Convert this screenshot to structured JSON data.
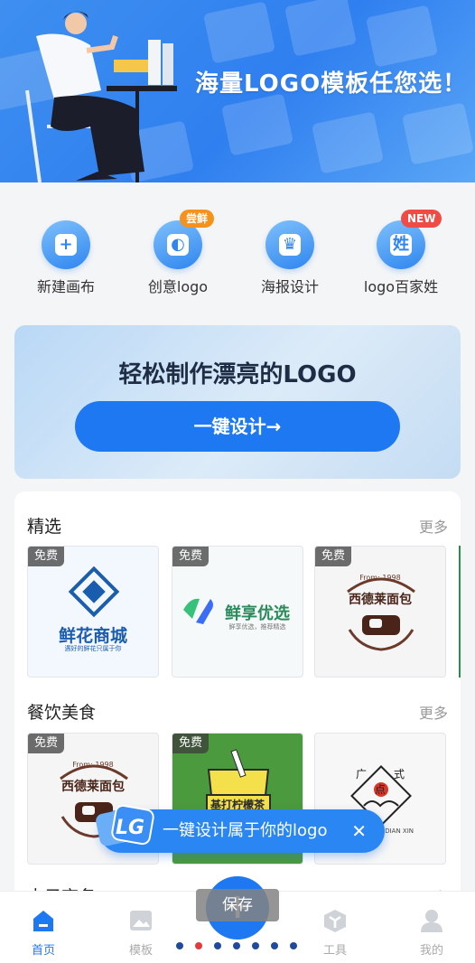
{
  "hero": {
    "title": "海量LOGO模板任您选！"
  },
  "actions": [
    {
      "label": "新建画布",
      "icon": "new-canvas-icon",
      "glyph": "+"
    },
    {
      "label": "创意logo",
      "icon": "creative-logo-icon",
      "glyph": "◐",
      "badge": "尝鲜"
    },
    {
      "label": "海报设计",
      "icon": "poster-design-icon",
      "glyph": "♛"
    },
    {
      "label": "logo百家姓",
      "icon": "surname-logo-icon",
      "glyph": "姓",
      "badge": "NEW"
    }
  ],
  "banner": {
    "title": "轻松制作漂亮的LOGO",
    "button": "一键设计→"
  },
  "sections": [
    {
      "title": "精选",
      "more": "更多",
      "templates": [
        {
          "free": "免费",
          "name": "鲜花商城",
          "slogan": "遇好的鲜花只属于你"
        },
        {
          "free": "免费",
          "name": "鲜享优选",
          "slogan": "鲜享优选，推荐精选"
        },
        {
          "free": "免费",
          "name": "西德莱面包",
          "badge": "From: 1998"
        }
      ]
    },
    {
      "title": "餐饮美食",
      "more": "更多",
      "templates": [
        {
          "free": "免费",
          "name": "西德莱面包",
          "badge": "From: 1998"
        },
        {
          "free": "免费",
          "name": "基打柠檬茶"
        },
        {
          "name": "广式点",
          "caption": "GUANG SHI DIAN XIN"
        }
      ]
    },
    {
      "title": "电子商务",
      "more": "更多"
    }
  ],
  "promo": {
    "text": "一键设计属于你的logo",
    "close": "✕",
    "logo": "LG"
  },
  "save_label": "保存",
  "fab_glyph": "+",
  "nav": [
    {
      "label": "首页",
      "active": true
    },
    {
      "label": "模板"
    },
    {
      "label": "工具"
    },
    {
      "label": "我的"
    }
  ],
  "colors": {
    "primary": "#1d78f2",
    "hero": "#3e8ff0",
    "badge_orange": "#f5921e",
    "badge_red": "#f04b45",
    "active_dot": "#e23b3b"
  }
}
